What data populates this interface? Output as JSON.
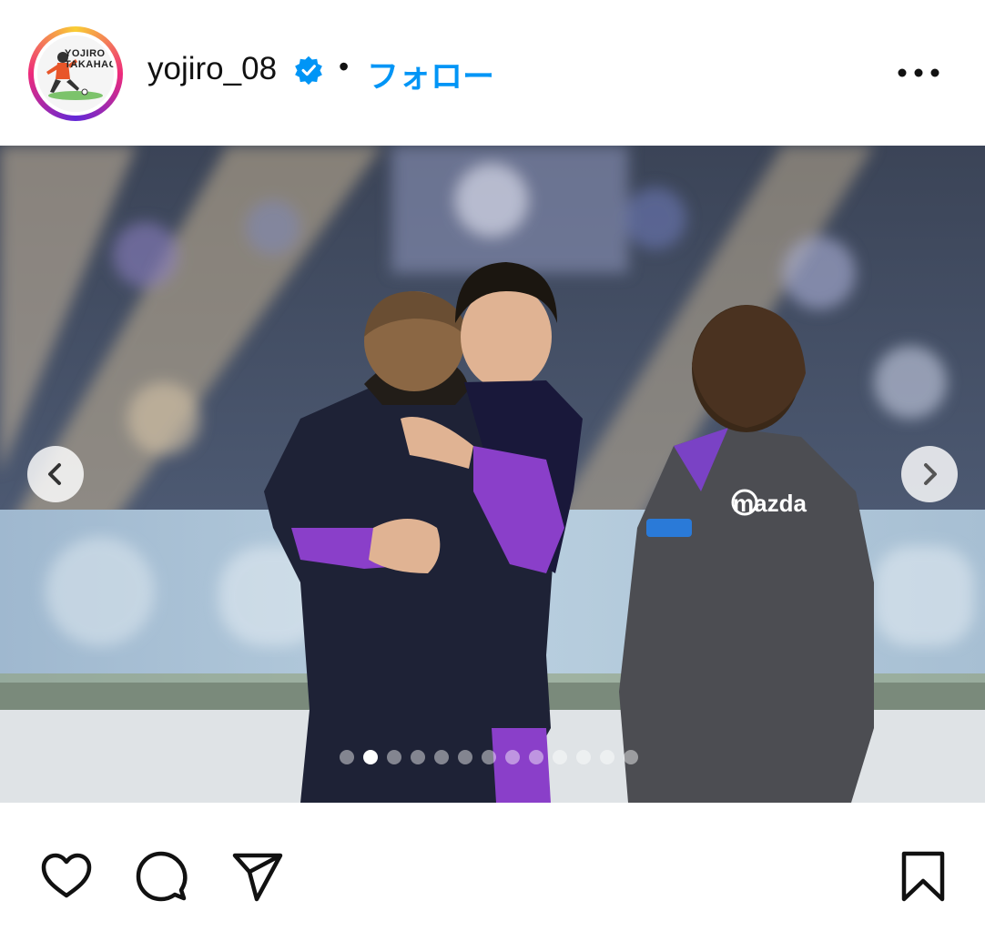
{
  "header": {
    "username": "yojiro_08",
    "separator": "•",
    "follow_label": "フォロー",
    "avatar_text_line1": "YOJIRO",
    "avatar_text_line2": "TAKAHAGI",
    "verified_icon": "verified-badge-icon",
    "more_icon": "more-options-icon"
  },
  "photo": {
    "jacket_logo": "mazda",
    "prev_icon": "chevron-left-icon",
    "next_icon": "chevron-right-icon"
  },
  "carousel": {
    "total": 13,
    "active_index": 1
  },
  "actions": {
    "like_icon": "heart-icon",
    "comment_icon": "comment-icon",
    "share_icon": "send-icon",
    "save_icon": "bookmark-icon"
  },
  "colors": {
    "follow": "#0095f6",
    "verified": "#0095f6",
    "text": "#111111"
  }
}
